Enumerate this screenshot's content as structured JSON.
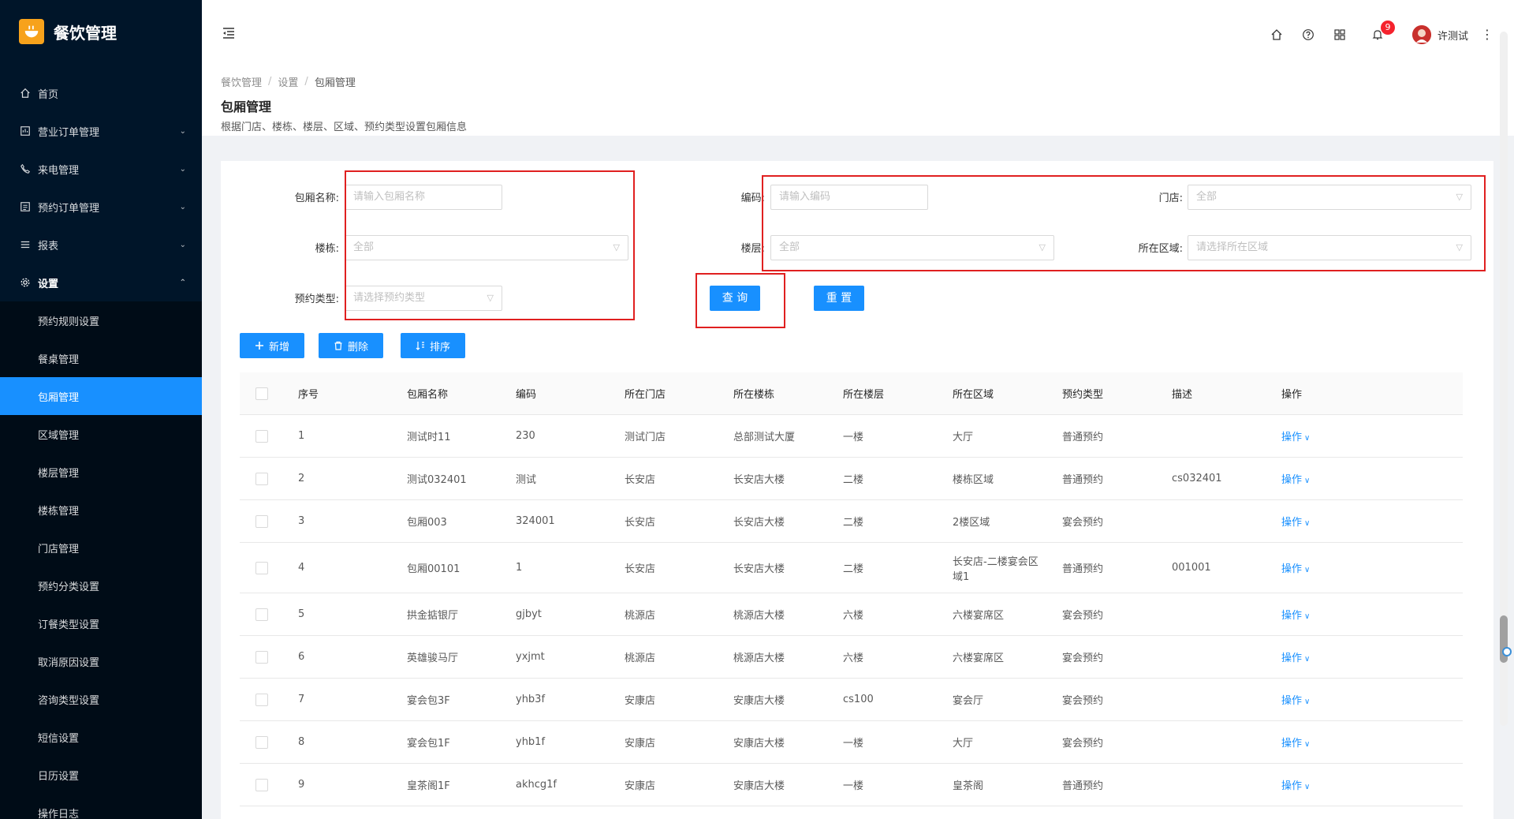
{
  "app": {
    "title": "餐饮管理"
  },
  "sidebar": {
    "items": [
      {
        "label": "首页",
        "icon": "home-icon",
        "has_arrow": false
      },
      {
        "label": "营业订单管理",
        "icon": "order-icon",
        "has_arrow": true
      },
      {
        "label": "来电管理",
        "icon": "phone-icon",
        "has_arrow": true
      },
      {
        "label": "预约订单管理",
        "icon": "calendar-order-icon",
        "has_arrow": true
      },
      {
        "label": "报表",
        "icon": "list-icon",
        "has_arrow": true
      },
      {
        "label": "设置",
        "icon": "gear-icon",
        "has_arrow": true,
        "open": true
      }
    ],
    "sub_items": [
      {
        "label": "预约规则设置"
      },
      {
        "label": "餐桌管理"
      },
      {
        "label": "包厢管理",
        "active": true
      },
      {
        "label": "区域管理"
      },
      {
        "label": "楼层管理"
      },
      {
        "label": "楼栋管理"
      },
      {
        "label": "门店管理"
      },
      {
        "label": "预约分类设置"
      },
      {
        "label": "订餐类型设置"
      },
      {
        "label": "取消原因设置"
      },
      {
        "label": "咨询类型设置"
      },
      {
        "label": "短信设置"
      },
      {
        "label": "日历设置"
      },
      {
        "label": "操作日志"
      }
    ]
  },
  "header": {
    "notification_count": "9",
    "user_name": "许测试",
    "more": "⋮"
  },
  "breadcrumb": [
    "餐饮管理",
    "设置",
    "包厢管理"
  ],
  "page": {
    "title": "包厢管理",
    "description": "根据门店、楼栋、楼层、区域、预约类型设置包厢信息"
  },
  "filters": {
    "room_name_label": "包厢名称:",
    "room_name_placeholder": "请输入包厢名称",
    "code_label": "编码:",
    "code_placeholder": "请输入编码",
    "store_label": "门店:",
    "store_value": "全部",
    "building_label": "楼栋:",
    "building_value": "全部",
    "floor_label": "楼层:",
    "floor_value": "全部",
    "area_label": "所在区域:",
    "area_placeholder": "请选择所在区域",
    "booking_type_label": "预约类型:",
    "booking_type_placeholder": "请选择预约类型",
    "query_button": "查 询",
    "reset_button": "重 置"
  },
  "toolbar": {
    "add_label": "新增",
    "delete_label": "删除",
    "sort_label": "排序"
  },
  "table": {
    "columns": [
      "序号",
      "包厢名称",
      "编码",
      "所在门店",
      "所在楼栋",
      "所在楼层",
      "所在区域",
      "预约类型",
      "描述",
      "操作"
    ],
    "op_label": "操作",
    "rows": [
      {
        "idx": "1",
        "name": "测试时11",
        "code": "230",
        "store": "测试门店",
        "building": "总部测试大厦",
        "floor": "一楼",
        "area": "大厅",
        "type": "普通预约",
        "desc": ""
      },
      {
        "idx": "2",
        "name": "测试032401",
        "code": "测试",
        "store": "长安店",
        "building": "长安店大楼",
        "floor": "二楼",
        "area": "楼栋区域",
        "type": "普通预约",
        "desc": "cs032401"
      },
      {
        "idx": "3",
        "name": "包厢003",
        "code": "324001",
        "store": "长安店",
        "building": "长安店大楼",
        "floor": "二楼",
        "area": "2楼区域",
        "type": "宴会预约",
        "desc": ""
      },
      {
        "idx": "4",
        "name": "包厢00101",
        "code": "1",
        "store": "长安店",
        "building": "长安店大楼",
        "floor": "二楼",
        "area": "长安店-二楼宴会区域1",
        "type": "普通预约",
        "desc": "001001"
      },
      {
        "idx": "5",
        "name": "拱金掂银厅",
        "code": "gjbyt",
        "store": "桃源店",
        "building": "桃源店大楼",
        "floor": "六楼",
        "area": "六楼宴席区",
        "type": "宴会预约",
        "desc": ""
      },
      {
        "idx": "6",
        "name": "英雄骏马厅",
        "code": "yxjmt",
        "store": "桃源店",
        "building": "桃源店大楼",
        "floor": "六楼",
        "area": "六楼宴席区",
        "type": "宴会预约",
        "desc": ""
      },
      {
        "idx": "7",
        "name": "宴会包3F",
        "code": "yhb3f",
        "store": "安康店",
        "building": "安康店大楼",
        "floor": "cs100",
        "area": "宴会厅",
        "type": "宴会预约",
        "desc": ""
      },
      {
        "idx": "8",
        "name": "宴会包1F",
        "code": "yhb1f",
        "store": "安康店",
        "building": "安康店大楼",
        "floor": "一楼",
        "area": "大厅",
        "type": "宴会预约",
        "desc": ""
      },
      {
        "idx": "9",
        "name": "皇茶阁1F",
        "code": "akhcg1f",
        "store": "安康店",
        "building": "安康店大楼",
        "floor": "一楼",
        "area": "皇茶阁",
        "type": "普通预约",
        "desc": ""
      }
    ]
  },
  "colors": {
    "primary": "#1890ff",
    "sidebar_bg": "#001529",
    "annotation_red": "#e02020",
    "logo_orange": "#f7a21b"
  }
}
